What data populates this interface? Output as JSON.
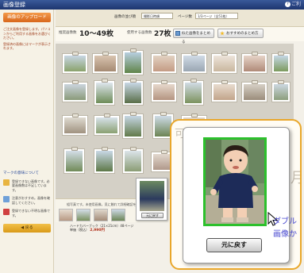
{
  "window": {
    "title": "画像登録",
    "help_label": "ご利"
  },
  "sidebar": {
    "upload_button": "画像のアップロード",
    "notes": [
      "ご注文画像を登録します。パソコンからご利用する画像をお選びください。",
      "登録済の画像にはマークが表示されます。"
    ],
    "legend_title": "マークの意味について",
    "legend": [
      {
        "text": "登録できない画像です。必要画像数は不足しています。",
        "color": "#e8b440"
      },
      {
        "text": "注意がおすすめ。画像を確認してください。",
        "color": "#6fa0d8"
      },
      {
        "text": "登録できない不明な画像です。",
        "color": "#d04040"
      }
    ],
    "back_button": "◀ 戻る"
  },
  "toolbar": {
    "sort_label": "画像の並び順",
    "sort_value": "撮影日時順",
    "page_label": "ページ数",
    "page_value": "1/3ページ（全51枚）"
  },
  "info": {
    "required_label": "推奨画像数",
    "required_value": "10〜49枚",
    "used_label": "使用する画像数",
    "used_value": "27枚",
    "group_button": "似た画像をまとめる",
    "recommend_button": "おすすめのまとめ方"
  },
  "strip": {
    "note": "組写真です。未使用画像。見に触れて詳細確認を",
    "selected_button": "元に戻す"
  },
  "footer": {
    "product": "ハードカバーブック（21×21cm）48ページ",
    "price_label": "単価（税込）",
    "price": "2,990円"
  },
  "zoom": {
    "restore_button": "元に戻す",
    "side_text_1": "ダブル",
    "side_text_2": "画像か",
    "bg_text_1": "可能",
    "bg_text_2": "月"
  },
  "colors": {
    "accent": "#e9a72a",
    "selected_border": "#2cc02c",
    "upload": "#e57f2c"
  }
}
